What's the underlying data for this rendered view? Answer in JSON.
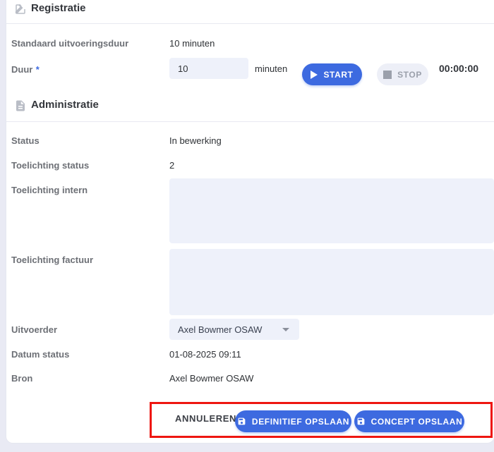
{
  "sections": {
    "registratie": {
      "title": "Registratie",
      "icon": "edit-icon",
      "rows": {
        "standaard_duur": {
          "label": "Standaard uitvoeringsduur",
          "value": "10 minuten"
        },
        "duur": {
          "label": "Duur",
          "required_marker": "*",
          "input_value": "10",
          "unit": "minuten"
        }
      },
      "timer": {
        "start_label": "START",
        "stop_label": "STOP",
        "elapsed": "00:00:00"
      }
    },
    "administratie": {
      "title": "Administratie",
      "icon": "document-icon",
      "rows": {
        "status": {
          "label": "Status",
          "value": "In bewerking"
        },
        "toelichting_status": {
          "label": "Toelichting status",
          "value": "2"
        },
        "toelichting_intern": {
          "label": "Toelichting intern",
          "value": ""
        },
        "toelichting_factuur": {
          "label": "Toelichting factuur",
          "value": ""
        },
        "uitvoerder": {
          "label": "Uitvoerder",
          "selected": "Axel Bowmer OSAW"
        },
        "datum_status": {
          "label": "Datum status",
          "value": "01-08-2025 09:11"
        },
        "bron": {
          "label": "Bron",
          "value": "Axel Bowmer OSAW"
        }
      }
    }
  },
  "footer": {
    "annuleren_label": "ANNULEREN",
    "definitief_label": "DEFINITIEF OPSLAAN",
    "concept_label": "CONCEPT OPSLAAN",
    "save_icon": "floppy-disk-icon"
  },
  "annotation": {
    "type": "highlight-rectangle",
    "color": "#ee1610"
  },
  "colors": {
    "primary": "#3d6ae0",
    "field_background": "#eef1fa",
    "disabled_button": "#edeff7",
    "label_text": "#6d7076",
    "value_text": "#2e3135",
    "divider": "#e8e9f1",
    "page_background": "#e9eaf4",
    "annotation_red": "#ee1610"
  }
}
